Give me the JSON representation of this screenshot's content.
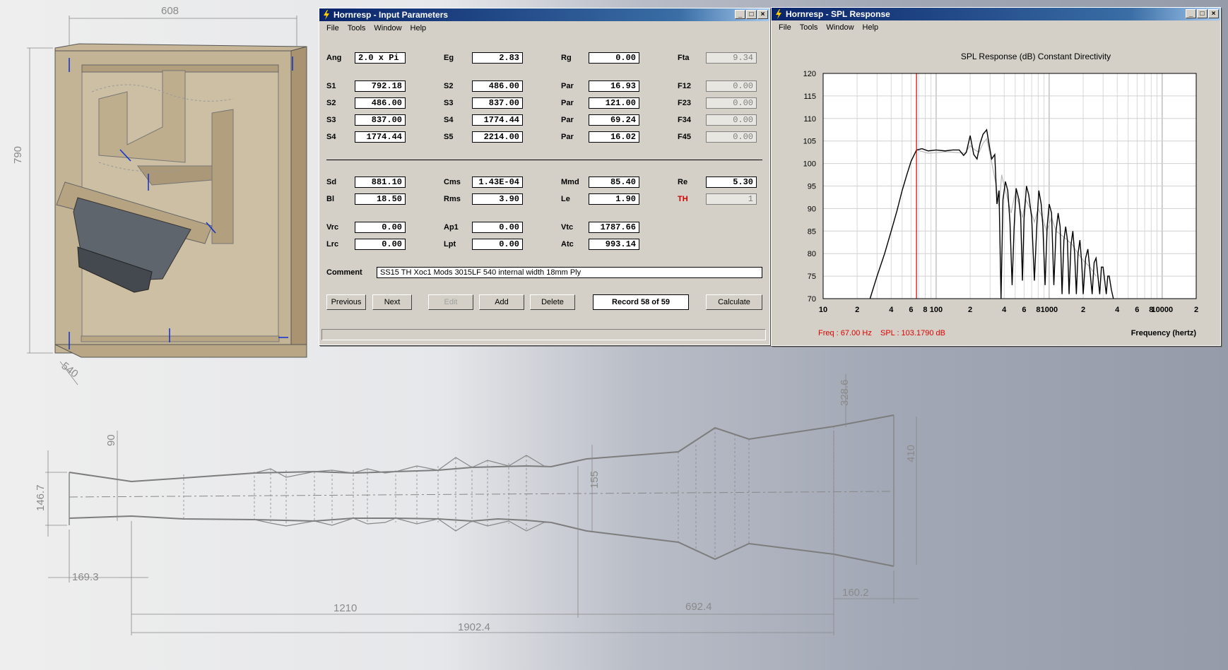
{
  "cad": {
    "dims": {
      "width_608": "608",
      "height_790": "790",
      "depth_540": "540",
      "d_90": "90",
      "d_146_7": "146.7",
      "d_169_3": "169.3",
      "d_155": "155",
      "d_1210": "1210",
      "d_692_4": "692.4",
      "d_1902_4": "1902.4",
      "d_160_2": "160.2",
      "d_328_6": "328.6",
      "d_410": "410"
    }
  },
  "input_window": {
    "title": "Hornresp - Input Parameters",
    "menu": [
      "File",
      "Tools",
      "Window",
      "Help"
    ],
    "params": {
      "Ang": {
        "label": "Ang",
        "value": "2.0 x Pi"
      },
      "Eg": {
        "label": "Eg",
        "value": "2.83"
      },
      "Rg": {
        "label": "Rg",
        "value": "0.00"
      },
      "Fta": {
        "label": "Fta",
        "value": "9.34"
      },
      "S1a": {
        "label": "S1",
        "value": "792.18"
      },
      "S2b": {
        "label": "S2",
        "value": "486.00"
      },
      "Par1": {
        "label": "Par",
        "value": "16.93"
      },
      "F12": {
        "label": "F12",
        "value": "0.00"
      },
      "S2a": {
        "label": "S2",
        "value": "486.00"
      },
      "S3b": {
        "label": "S3",
        "value": "837.00"
      },
      "Par2": {
        "label": "Par",
        "value": "121.00"
      },
      "F23": {
        "label": "F23",
        "value": "0.00"
      },
      "S3a": {
        "label": "S3",
        "value": "837.00"
      },
      "S4b": {
        "label": "S4",
        "value": "1774.44"
      },
      "Par3": {
        "label": "Par",
        "value": "69.24"
      },
      "F34": {
        "label": "F34",
        "value": "0.00"
      },
      "S4a": {
        "label": "S4",
        "value": "1774.44"
      },
      "S5b": {
        "label": "S5",
        "value": "2214.00"
      },
      "Par4": {
        "label": "Par",
        "value": "16.02"
      },
      "F45": {
        "label": "F45",
        "value": "0.00"
      },
      "Sd": {
        "label": "Sd",
        "value": "881.10"
      },
      "Cms": {
        "label": "Cms",
        "value": "1.43E-04"
      },
      "Mmd": {
        "label": "Mmd",
        "value": "85.40"
      },
      "Re": {
        "label": "Re",
        "value": "5.30"
      },
      "Bl": {
        "label": "Bl",
        "value": "18.50"
      },
      "Rms": {
        "label": "Rms",
        "value": "3.90"
      },
      "Le": {
        "label": "Le",
        "value": "1.90"
      },
      "TH": {
        "label": "TH",
        "value": "1"
      },
      "Vrc": {
        "label": "Vrc",
        "value": "0.00"
      },
      "Ap1": {
        "label": "Ap1",
        "value": "0.00"
      },
      "Vtc": {
        "label": "Vtc",
        "value": "1787.66"
      },
      "Lrc": {
        "label": "Lrc",
        "value": "0.00"
      },
      "Lpt": {
        "label": "Lpt",
        "value": "0.00"
      },
      "Atc": {
        "label": "Atc",
        "value": "993.14"
      }
    },
    "comment_label": "Comment",
    "comment_value": "SS15 TH Xoc1 Mods 3015LF 540 internal width 18mm Ply",
    "buttons": {
      "previous": "Previous",
      "next": "Next",
      "edit": "Edit",
      "add": "Add",
      "delete": "Delete",
      "calculate": "Calculate"
    },
    "record": "Record 58 of 59"
  },
  "spl_window": {
    "title": "Hornresp - SPL Response",
    "menu": [
      "File",
      "Tools",
      "Window",
      "Help"
    ],
    "freq_readout": "Freq : 67.00 Hz",
    "spl_readout": "SPL : 103.1790 dB",
    "colors": {
      "cursor": "#dd0000",
      "trace": "#000000",
      "trace2": "#b8b8b8"
    }
  },
  "chart_data": {
    "type": "line",
    "title": "SPL Response (dB)   Constant Directivity",
    "xlabel": "Frequency (hertz)",
    "ylabel": "",
    "xscale": "log",
    "xlim": [
      10,
      20000
    ],
    "ylim": [
      70,
      120
    ],
    "y_ticks": [
      70,
      75,
      80,
      85,
      90,
      95,
      100,
      105,
      110,
      115,
      120
    ],
    "x_tick_values": [
      10,
      20,
      40,
      60,
      80,
      100,
      200,
      400,
      600,
      800,
      1000,
      2000,
      4000,
      6000,
      8000,
      10000,
      20000
    ],
    "x_tick_labels": [
      "10",
      "2",
      "4",
      "6",
      "8",
      "100",
      "2",
      "4",
      "6",
      "8",
      "1000",
      "2",
      "4",
      "6",
      "8",
      "10000",
      "2"
    ],
    "grid": true,
    "cursor_x": 67,
    "series": [
      {
        "x": [
          26,
          30,
          35,
          40,
          45,
          50,
          55,
          60,
          67,
          75,
          85,
          100,
          120,
          140,
          160,
          175,
          185,
          200,
          215,
          230,
          245,
          260,
          280,
          295,
          310,
          330,
          345,
          360,
          375,
          390,
          410,
          430,
          450,
          470,
          490,
          510,
          540,
          560,
          580,
          600,
          630,
          660,
          700,
          740,
          780,
          810,
          850,
          880,
          920,
          960,
          1000,
          1050,
          1100,
          1150,
          1200,
          1250,
          1300,
          1350,
          1400,
          1450,
          1500,
          1560,
          1620,
          1680,
          1740,
          1800,
          1870,
          1940,
          2000,
          2100,
          2200,
          2300,
          2400,
          2500,
          2600,
          2700,
          2800,
          2900,
          3000,
          3100,
          3200,
          3300,
          3400,
          3550,
          3700
        ],
        "y": [
          70,
          75,
          80,
          85,
          89.5,
          94,
          97.5,
          100.5,
          103,
          103.3,
          102.8,
          103,
          102.8,
          103,
          103,
          101.8,
          102.5,
          106.2,
          102,
          101,
          104.5,
          106.5,
          107.5,
          104,
          101,
          102,
          91,
          94,
          70,
          92,
          96,
          94,
          87,
          73,
          86,
          94.5,
          92,
          88,
          74,
          88,
          95,
          93,
          88,
          74,
          87,
          94,
          91,
          86,
          73,
          86,
          91,
          89,
          73,
          85,
          89,
          86,
          71,
          83,
          86,
          83,
          71,
          82,
          85,
          80,
          71,
          80,
          83,
          78,
          71,
          79,
          81,
          76,
          71,
          78,
          79,
          75,
          71,
          77,
          77,
          74,
          71,
          75,
          75,
          72,
          70
        ]
      },
      {
        "x": [
          67,
          85,
          100,
          120,
          140,
          160,
          180,
          200,
          220,
          240,
          260,
          280,
          300,
          320,
          340,
          360,
          380,
          400,
          430,
          460,
          500,
          540,
          580,
          620,
          680,
          740,
          800,
          870,
          950,
          1050,
          1150,
          1300,
          1450,
          1600,
          1800,
          2000,
          2300,
          2600
        ],
        "y": [
          103,
          102.3,
          102.4,
          102.6,
          102.5,
          102.4,
          102.3,
          104,
          103,
          102.5,
          104.5,
          105.5,
          102,
          98.5,
          95,
          90.5,
          97.5,
          95,
          92,
          89,
          93.5,
          91,
          88,
          92,
          90,
          87,
          90,
          88,
          85,
          88,
          85,
          84,
          83,
          82,
          80,
          78.5,
          77,
          75
        ]
      }
    ]
  }
}
